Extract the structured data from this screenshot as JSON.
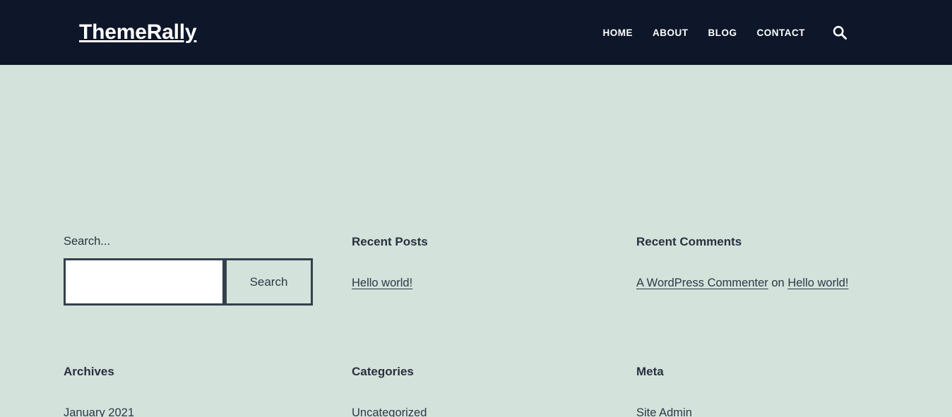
{
  "header": {
    "logo": "ThemeRally",
    "nav": [
      {
        "label": "HOME"
      },
      {
        "label": "ABOUT"
      },
      {
        "label": "BLOG"
      },
      {
        "label": "CONTACT"
      }
    ],
    "search_icon": "search-icon"
  },
  "widgets": {
    "search": {
      "label": "Search...",
      "input_value": "",
      "input_placeholder": "",
      "button_label": "Search"
    },
    "recent_posts": {
      "title": "Recent Posts",
      "items": [
        {
          "label": "Hello world!"
        }
      ]
    },
    "recent_comments": {
      "title": "Recent Comments",
      "items": [
        {
          "author": "A WordPress Commenter",
          "connector": "on",
          "post": "Hello world!"
        }
      ]
    },
    "archives": {
      "title": "Archives",
      "items": [
        {
          "label": "January 2021"
        }
      ]
    },
    "categories": {
      "title": "Categories",
      "items": [
        {
          "label": "Uncategorized"
        }
      ]
    },
    "meta": {
      "title": "Meta",
      "items": [
        {
          "label": "Site Admin"
        }
      ]
    }
  },
  "colors": {
    "header_bg": "#0e1629",
    "page_bg": "#d3e2db",
    "text": "#2b3440",
    "heading": "#28303e",
    "border": "#34404c",
    "input_bg": "#ffffff"
  }
}
